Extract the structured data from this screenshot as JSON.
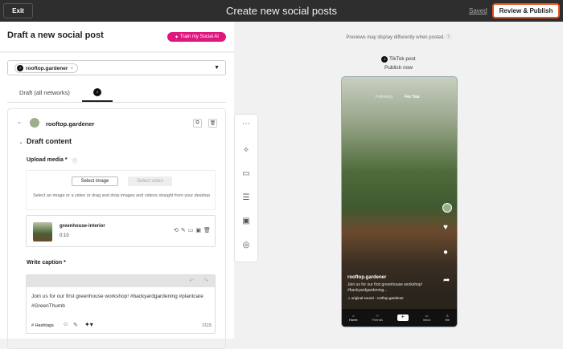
{
  "header": {
    "exit": "Exit",
    "title": "Create new social posts",
    "saved": "Saved",
    "review_publish": "Review & Publish"
  },
  "left": {
    "title": "Draft a new social post",
    "train": "Train my Social AI",
    "account_chip": "rooftop.gardener",
    "tabs": [
      "Draft (all networks)"
    ],
    "card": {
      "account": "rooftop.gardener",
      "section": "Draft content",
      "upload_label": "Upload media *",
      "select_image": "Select image",
      "select_video": "Select video",
      "upload_hint": "Select an image or a video or drag and drop images and videos straight from your desktop",
      "media_name": "greenhouse-interior",
      "media_duration": "0:10",
      "caption_label": "Write caption *",
      "caption": "Join us for our first greenhouse workshop! #backyardgardening #plantcare #GreenThumb",
      "hashtags": "# Hashtags",
      "char_count": "2115"
    }
  },
  "preview": {
    "note": "Previews may display differently when posted. ⓘ",
    "network": "TikTok post",
    "schedule": "Publish now",
    "phone": {
      "tab_following": "Following",
      "tab_foryou": "For You",
      "username": "rooftop.gardener",
      "caption": "Join us for our first greenhouse workshop! #backyardgardening...",
      "sound": "original sound - rooftop.gardener",
      "nav": [
        "Home",
        "Friends",
        "Inbox",
        "Me"
      ]
    }
  }
}
